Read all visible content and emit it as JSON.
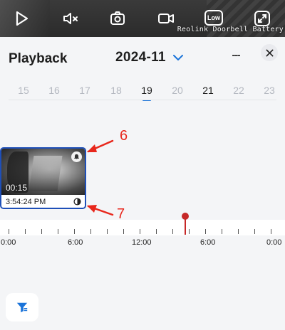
{
  "video": {
    "controls": [
      "play-icon",
      "mute-icon",
      "snapshot-icon",
      "record-icon",
      "low-quality-icon",
      "fullscreen-icon"
    ],
    "quality_label": "Low",
    "watermark": "Reolink Doorbell Battery"
  },
  "header": {
    "title": "Playback",
    "month": "2024-11",
    "more_label": "---",
    "close_icon": "close-icon"
  },
  "days": [
    {
      "label": "15",
      "state": "disabled"
    },
    {
      "label": "16",
      "state": "disabled"
    },
    {
      "label": "17",
      "state": "disabled"
    },
    {
      "label": "18",
      "state": "disabled"
    },
    {
      "label": "19",
      "state": "selected"
    },
    {
      "label": "20",
      "state": "disabled"
    },
    {
      "label": "21",
      "state": "available"
    },
    {
      "label": "22",
      "state": "disabled"
    },
    {
      "label": "23",
      "state": "disabled"
    }
  ],
  "clip": {
    "duration": "00:15",
    "time": "3:54:24 PM",
    "event_icon": "bell-icon",
    "type_icon": "half-circle-icon"
  },
  "annotations": {
    "six": "6",
    "seven": "7"
  },
  "timeline": {
    "labels": [
      "0:00",
      "6:00",
      "12:00",
      "6:00",
      "0:00"
    ]
  },
  "colors": {
    "accent": "#1a73d9",
    "clip_border": "#1e4fb8",
    "cursor": "#c62828",
    "annotation": "#e8271c"
  }
}
